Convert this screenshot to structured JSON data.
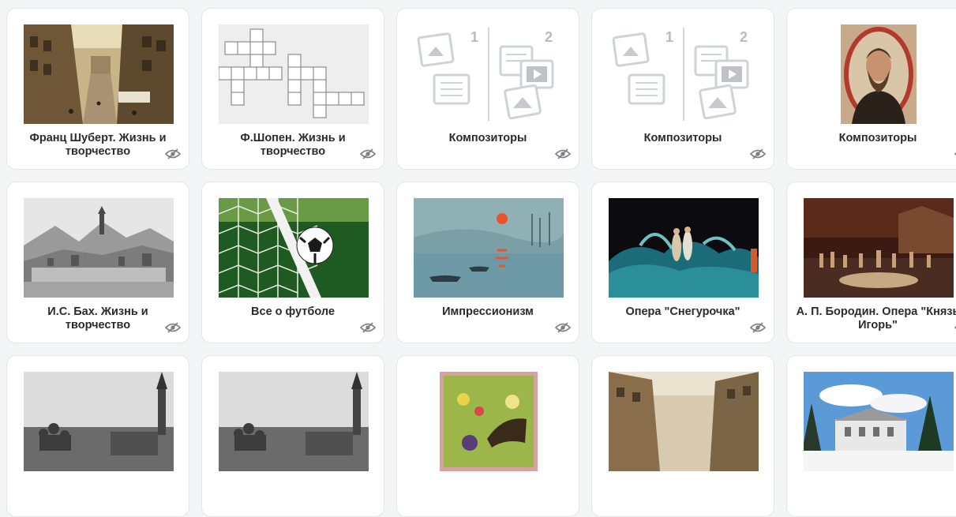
{
  "cards": [
    {
      "title": "Франц Шуберт. Жизнь и творчество",
      "thumb": "street-photo",
      "icon": "hidden-eye-icon"
    },
    {
      "title": "Ф.Шопен. Жизнь и творчество",
      "thumb": "crossword",
      "icon": "hidden-eye-icon"
    },
    {
      "title": "Композиторы",
      "thumb": "app-placeholder",
      "icon": "hidden-eye-icon"
    },
    {
      "title": "Композиторы",
      "thumb": "app-placeholder",
      "icon": "hidden-eye-icon"
    },
    {
      "title": "Композиторы",
      "thumb": "portrait",
      "icon": "hidden-eye-icon"
    },
    {
      "title": "И.С. Бах. Жизнь и творчество",
      "thumb": "landscape-engraving",
      "icon": "hidden-eye-icon"
    },
    {
      "title": "Все о футболе",
      "thumb": "soccer-ball-net",
      "icon": "hidden-eye-icon"
    },
    {
      "title": "Импрессионизм",
      "thumb": "impression-sunrise",
      "icon": "hidden-eye-icon"
    },
    {
      "title": "Опера \"Снегурочка\"",
      "thumb": "opera-stage-blue",
      "icon": "hidden-eye-icon"
    },
    {
      "title": "А. П. Бородин. Опера \"Князь Игорь\"",
      "thumb": "opera-stage-dark",
      "icon": "hidden-eye-icon"
    },
    {
      "title": "",
      "thumb": "kremlin-photo",
      "icon": ""
    },
    {
      "title": "",
      "thumb": "kremlin-photo",
      "icon": ""
    },
    {
      "title": "",
      "thumb": "gramophone-painting",
      "icon": ""
    },
    {
      "title": "",
      "thumb": "street-photo-2",
      "icon": ""
    },
    {
      "title": "",
      "thumb": "winter-estate",
      "icon": ""
    }
  ],
  "placeholder_numbers": [
    "1",
    "2"
  ]
}
